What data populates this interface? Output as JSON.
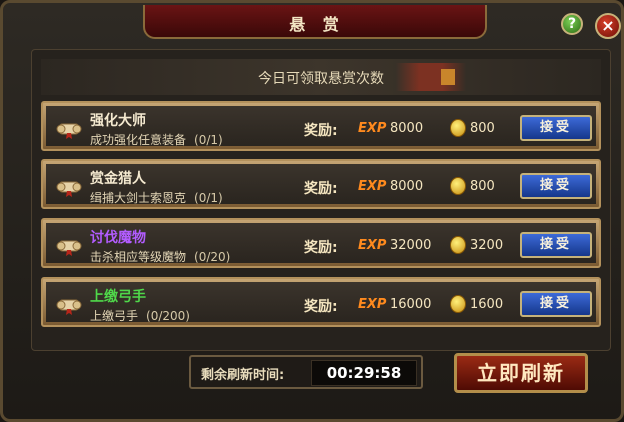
{
  "window": {
    "title": "悬 赏"
  },
  "header": {
    "help_label": "?",
    "close_label": "×"
  },
  "daily": {
    "label": "今日可领取悬赏次数"
  },
  "quests": [
    {
      "name": "强化大师",
      "name_color": "#f5ead0",
      "desc": "成功强化任意装备",
      "progress": "(0/1)",
      "reward_label": "奖励:",
      "exp_tag": "EXP",
      "exp": "8000",
      "gold": "800",
      "accept": "接受"
    },
    {
      "name": "赏金猎人",
      "name_color": "#f5ead0",
      "desc": "缉捕大剑士索恩克",
      "progress": "(0/1)",
      "reward_label": "奖励:",
      "exp_tag": "EXP",
      "exp": "8000",
      "gold": "800",
      "accept": "接受"
    },
    {
      "name": "讨伐魔物",
      "name_color": "#b25cff",
      "desc": "击杀相应等级魔物",
      "progress": "(0/20)",
      "reward_label": "奖励:",
      "exp_tag": "EXP",
      "exp": "32000",
      "gold": "3200",
      "accept": "接受"
    },
    {
      "name": "上缴弓手",
      "name_color": "#4fd84a",
      "desc": "上缴弓手",
      "progress": "(0/200)",
      "reward_label": "奖励:",
      "exp_tag": "EXP",
      "exp": "16000",
      "gold": "1600",
      "accept": "接受"
    }
  ],
  "footer": {
    "timer_label": "剩余刷新时间:",
    "timer_value": "00:29:58",
    "refresh_label": "立即刷新"
  }
}
